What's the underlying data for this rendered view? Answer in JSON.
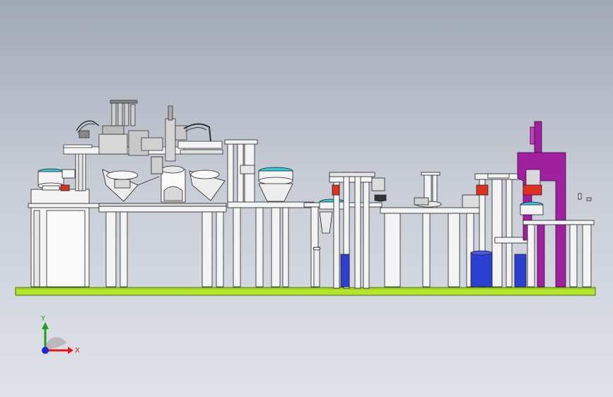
{
  "model_view": {
    "colors": {
      "background_top": "#a1a8b6",
      "background_bottom": "#dfe2e8",
      "floor_plate": "#b2e62c",
      "frame_white": "#f4f4f4",
      "outline": "#222222",
      "press_purple": "#a020a0",
      "hopper_blue": "#2b3fd0",
      "accent_red": "#e03020",
      "accent_cyan": "#38c8d8"
    },
    "triad": {
      "x_label": "X",
      "y_label": "Y",
      "x_color": "#e01818",
      "y_color": "#1ea01e",
      "z_color": "#1a2ad8"
    }
  }
}
